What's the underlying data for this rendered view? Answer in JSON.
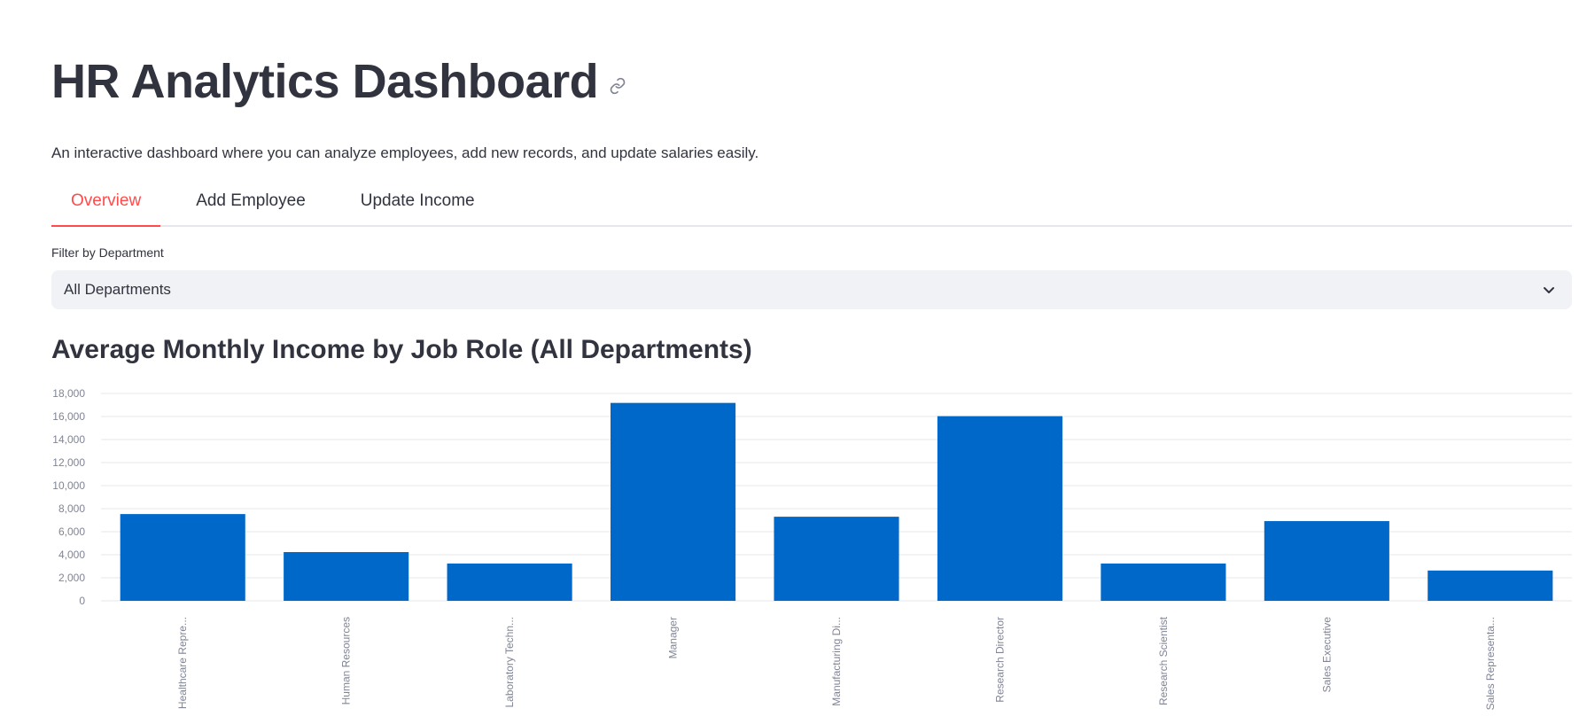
{
  "header": {
    "title": "HR Analytics Dashboard",
    "subtitle": "An interactive dashboard where you can analyze employees, add new records, and update salaries easily."
  },
  "tabs": [
    {
      "label": "Overview",
      "active": true
    },
    {
      "label": "Add Employee",
      "active": false
    },
    {
      "label": "Update Income",
      "active": false
    }
  ],
  "filter": {
    "label": "Filter by Department",
    "selected": "All Departments"
  },
  "chart_title": "Average Monthly Income by Job Role (All Departments)",
  "colors": {
    "accent": "#ff4b4b",
    "bar": "#0068c9",
    "text": "#31333f",
    "axis_text": "#808495",
    "grid": "#e6e7eb"
  },
  "chart_data": {
    "type": "bar",
    "title": "",
    "xlabel": "",
    "ylabel": "",
    "categories": [
      "Healthcare Repre...",
      "Human Resources",
      "Laboratory Techn...",
      "Manager",
      "Manufacturing Di...",
      "Research Director",
      "Research Scientist",
      "Sales Executive",
      "Sales Representa..."
    ],
    "values": [
      7530,
      4230,
      3240,
      17180,
      7300,
      16030,
      3240,
      6920,
      2630
    ],
    "ylim": [
      0,
      18000
    ],
    "yticks": [
      0,
      2000,
      4000,
      6000,
      8000,
      10000,
      12000,
      14000,
      16000,
      18000
    ],
    "ytick_labels": [
      "0",
      "2,000",
      "4,000",
      "6,000",
      "8,000",
      "10,000",
      "12,000",
      "14,000",
      "16,000",
      "18,000"
    ],
    "grid": true
  }
}
